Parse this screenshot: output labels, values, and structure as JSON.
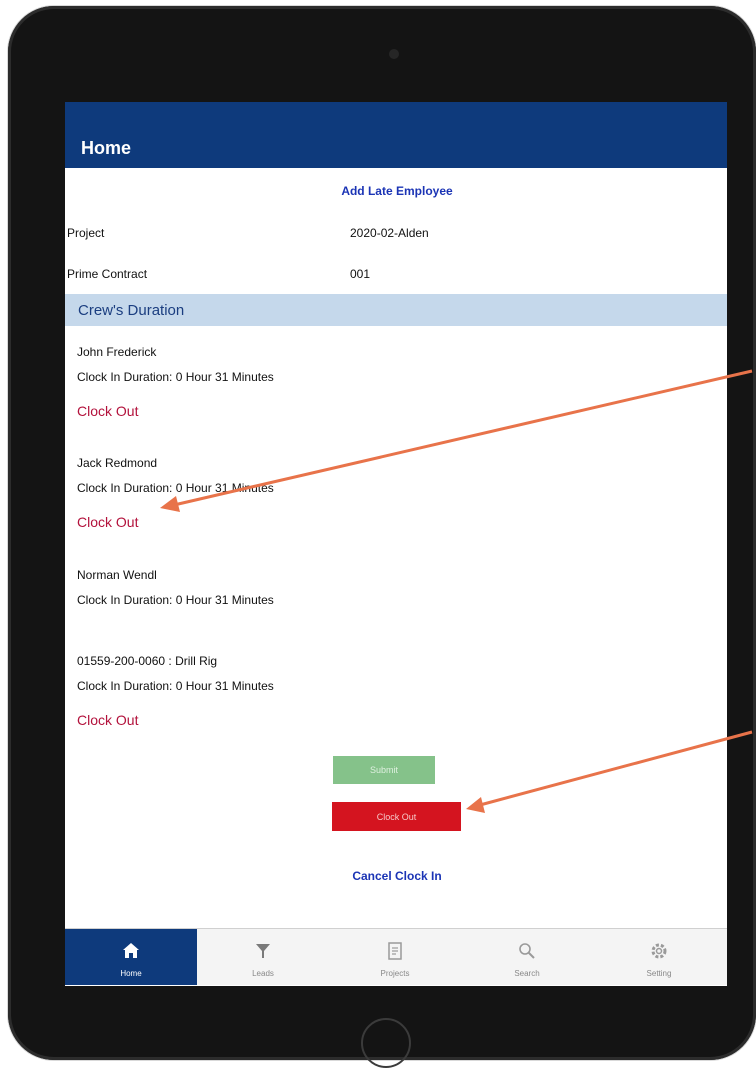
{
  "header": {
    "title": "Home"
  },
  "add_late_employee": "Add Late Employee",
  "fields": [
    {
      "label": "Project",
      "value": "2020-02-Alden"
    },
    {
      "label": "Prime Contract",
      "value": "001"
    }
  ],
  "section_title": "Crew's Duration",
  "crew": [
    {
      "name": "John Frederick",
      "duration": "Clock In Duration:  0 Hour 31 Minutes",
      "action": "Clock Out"
    },
    {
      "name": "Jack Redmond",
      "duration": "Clock In Duration:  0 Hour 31 Minutes",
      "action": "Clock Out"
    },
    {
      "name": "Norman Wendl",
      "duration": "Clock In Duration:  0 Hour 31 Minutes"
    },
    {
      "name": "01559-200-0060 : Drill Rig",
      "duration": "Clock In Duration:  0 Hour 31 Minutes",
      "action": "Clock Out"
    }
  ],
  "buttons": {
    "green": "Submit",
    "red": "Clock Out"
  },
  "cancel_clock_in": "Cancel Clock In",
  "tabs": [
    {
      "label": "Home",
      "icon": "home-icon"
    },
    {
      "label": "Leads",
      "icon": "filter-icon"
    },
    {
      "label": "Projects",
      "icon": "projects-icon"
    },
    {
      "label": "Search",
      "icon": "search-icon"
    },
    {
      "label": "Setting",
      "icon": "gear-icon"
    }
  ],
  "colors": {
    "header": "#0e3a7c",
    "link": "#1b34b5",
    "clock_out": "#b3123c",
    "annotation_arrow": "#e8734a",
    "green_button": "#85c28a",
    "red_button": "#d4141f"
  }
}
